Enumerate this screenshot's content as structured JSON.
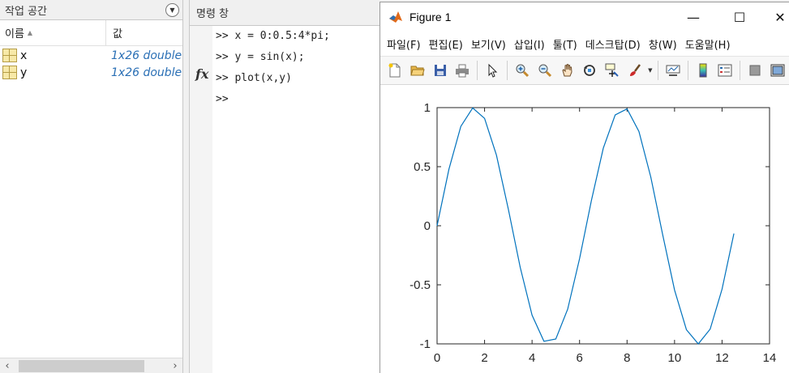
{
  "workspace": {
    "title": "작업 공간",
    "columns": {
      "name": "이름",
      "value": "값"
    },
    "variables": [
      {
        "name": "x",
        "value": "1x26 double"
      },
      {
        "name": "y",
        "value": "1x26 double"
      }
    ]
  },
  "command_window": {
    "title": "명령 창",
    "lines": [
      ">> x = 0:0.5:4*pi;",
      ">> y = sin(x);",
      ">> plot(x,y)",
      ">>"
    ],
    "fx_label": "fx"
  },
  "figure": {
    "title": "Figure 1",
    "menu": [
      "파일(F)",
      "편집(E)",
      "보기(V)",
      "삽입(I)",
      "툴(T)",
      "데스크탑(D)",
      "창(W)",
      "도움말(H)"
    ],
    "toolbar_icons": [
      "new-figure-icon",
      "open-file-icon",
      "save-icon",
      "print-icon",
      "edit-plot-arrow-icon",
      "zoom-in-icon",
      "zoom-out-icon",
      "pan-hand-icon",
      "rotate-3d-icon",
      "data-cursor-icon",
      "brush-icon",
      "link-plot-icon",
      "colorbar-icon",
      "legend-icon",
      "hide-plot-tools-icon",
      "show-plot-tools-icon"
    ],
    "line_color": "#0072bd"
  },
  "chart_data": {
    "type": "line",
    "x": [
      0,
      0.5,
      1,
      1.5,
      2,
      2.5,
      3,
      3.5,
      4,
      4.5,
      5,
      5.5,
      6,
      6.5,
      7,
      7.5,
      8,
      8.5,
      9,
      9.5,
      10,
      10.5,
      11,
      11.5,
      12,
      12.5
    ],
    "y": [
      0,
      0.479,
      0.841,
      0.997,
      0.909,
      0.598,
      0.141,
      -0.351,
      -0.757,
      -0.978,
      -0.959,
      -0.706,
      -0.279,
      0.215,
      0.657,
      0.938,
      0.989,
      0.798,
      0.412,
      -0.075,
      -0.544,
      -0.88,
      -1.0,
      -0.875,
      -0.537,
      -0.066
    ],
    "xlim": [
      0,
      14
    ],
    "ylim": [
      -1,
      1
    ],
    "xticks": [
      0,
      2,
      4,
      6,
      8,
      10,
      12,
      14
    ],
    "yticks": [
      1,
      0.5,
      0,
      -0.5,
      -1
    ],
    "ytick_labels": [
      "1",
      "0.5",
      "0",
      "-0.5",
      "-1"
    ],
    "title": "",
    "xlabel": "",
    "ylabel": ""
  }
}
